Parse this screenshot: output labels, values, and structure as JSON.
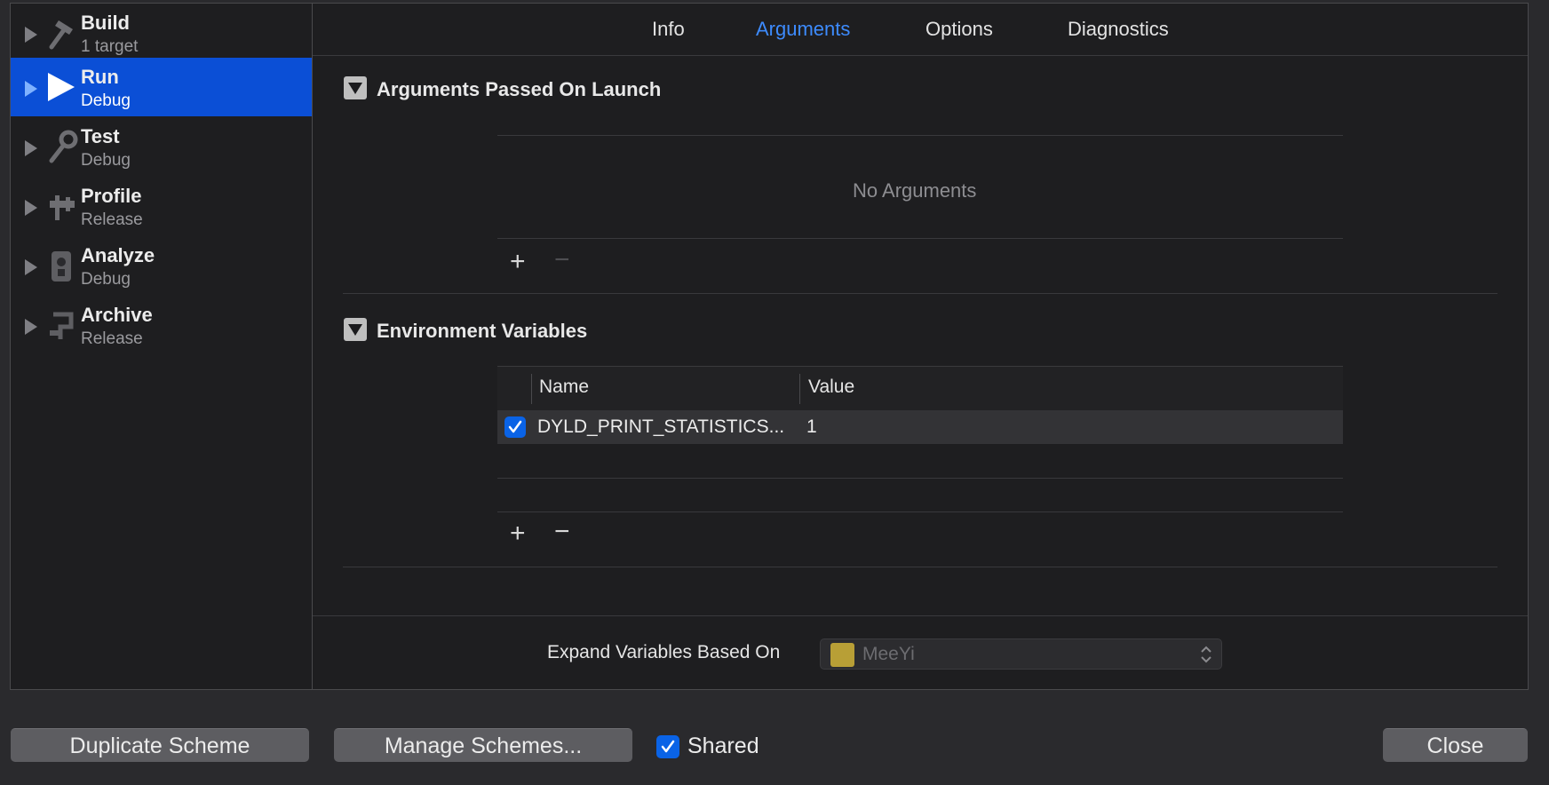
{
  "sidebar": {
    "items": [
      {
        "title": "Build",
        "subtitle": "1 target",
        "icon": "hammer-icon"
      },
      {
        "title": "Run",
        "subtitle": "Debug",
        "icon": "play-icon"
      },
      {
        "title": "Test",
        "subtitle": "Debug",
        "icon": "wrench-icon"
      },
      {
        "title": "Profile",
        "subtitle": "Release",
        "icon": "instrument-icon"
      },
      {
        "title": "Analyze",
        "subtitle": "Debug",
        "icon": "analyze-icon"
      },
      {
        "title": "Archive",
        "subtitle": "Release",
        "icon": "archive-icon"
      }
    ],
    "selected": "Run"
  },
  "tabs": [
    "Info",
    "Arguments",
    "Options",
    "Diagnostics"
  ],
  "active_tab": "Arguments",
  "arguments_section": {
    "title": "Arguments Passed On Launch",
    "empty_text": "No Arguments"
  },
  "env_section": {
    "title": "Environment Variables",
    "columns": [
      "Name",
      "Value"
    ],
    "rows": [
      {
        "checked": true,
        "name": "DYLD_PRINT_STATISTICS...",
        "value": "1"
      }
    ]
  },
  "expand": {
    "label": "Expand Variables Based On",
    "value": "MeeYi"
  },
  "footer": {
    "duplicate": "Duplicate Scheme",
    "manage": "Manage Schemes...",
    "shared_label": "Shared",
    "shared_checked": true,
    "close": "Close"
  },
  "colors": {
    "accent": "#0b4fd6",
    "active_tab": "#3d8bfd",
    "checkbox": "#0a63e6"
  }
}
